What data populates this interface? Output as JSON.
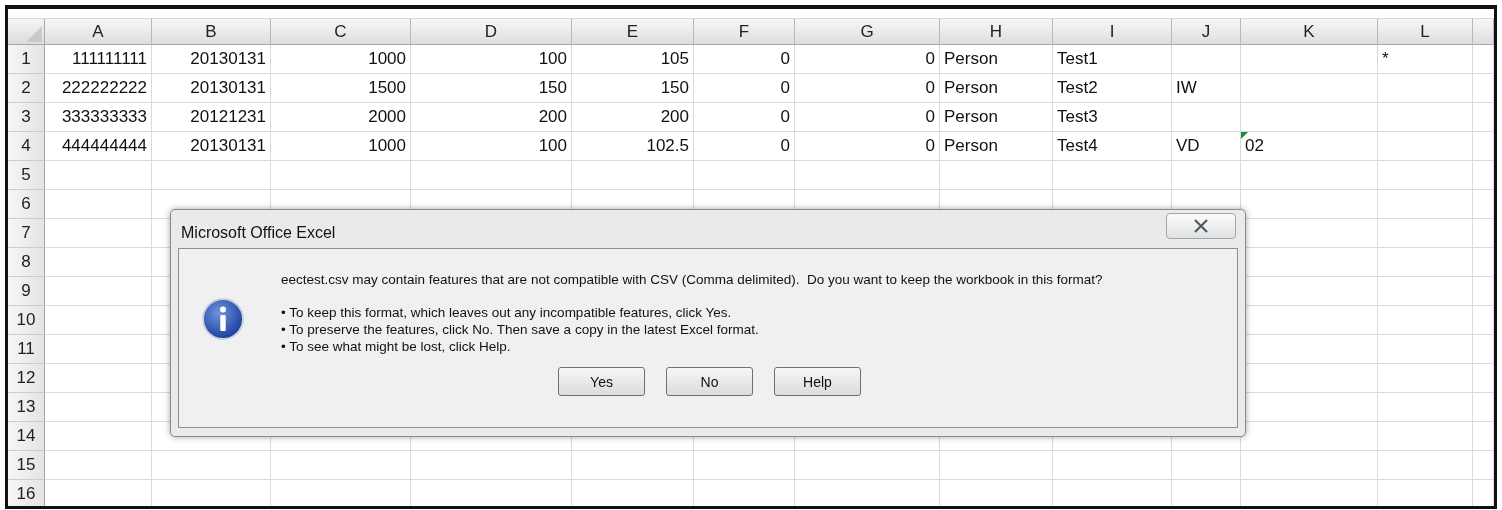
{
  "columns": [
    "A",
    "B",
    "C",
    "D",
    "E",
    "F",
    "G",
    "H",
    "I",
    "J",
    "K",
    "L"
  ],
  "rows": [
    {
      "header": "1",
      "cells": [
        {
          "text": "111111111",
          "kind": "number"
        },
        {
          "text": "20130131",
          "kind": "number"
        },
        {
          "text": "1000",
          "kind": "number"
        },
        {
          "text": "100",
          "kind": "number"
        },
        {
          "text": "105",
          "kind": "number"
        },
        {
          "text": "0",
          "kind": "number"
        },
        {
          "text": "0",
          "kind": "number"
        },
        {
          "text": "Person",
          "kind": "text"
        },
        {
          "text": "Test1",
          "kind": "text"
        },
        null,
        null,
        {
          "text": "*",
          "kind": "text"
        }
      ]
    },
    {
      "header": "2",
      "cells": [
        {
          "text": "222222222",
          "kind": "number"
        },
        {
          "text": "20130131",
          "kind": "number"
        },
        {
          "text": "1500",
          "kind": "number"
        },
        {
          "text": "150",
          "kind": "number"
        },
        {
          "text": "150",
          "kind": "number"
        },
        {
          "text": "0",
          "kind": "number"
        },
        {
          "text": "0",
          "kind": "number"
        },
        {
          "text": "Person",
          "kind": "text"
        },
        {
          "text": "Test2",
          "kind": "text"
        },
        {
          "text": "IW",
          "kind": "text"
        },
        null,
        null
      ]
    },
    {
      "header": "3",
      "cells": [
        {
          "text": "333333333",
          "kind": "number"
        },
        {
          "text": "20121231",
          "kind": "number"
        },
        {
          "text": "2000",
          "kind": "number"
        },
        {
          "text": "200",
          "kind": "number"
        },
        {
          "text": "200",
          "kind": "number"
        },
        {
          "text": "0",
          "kind": "number"
        },
        {
          "text": "0",
          "kind": "number"
        },
        {
          "text": "Person",
          "kind": "text"
        },
        {
          "text": "Test3",
          "kind": "text"
        },
        null,
        null,
        null
      ]
    },
    {
      "header": "4",
      "cells": [
        {
          "text": "444444444",
          "kind": "number"
        },
        {
          "text": "20130131",
          "kind": "number"
        },
        {
          "text": "1000",
          "kind": "number"
        },
        {
          "text": "100",
          "kind": "number"
        },
        {
          "text": "102.5",
          "kind": "number"
        },
        {
          "text": "0",
          "kind": "number"
        },
        {
          "text": "0",
          "kind": "number"
        },
        {
          "text": "Person",
          "kind": "text"
        },
        {
          "text": "Test4",
          "kind": "text"
        },
        {
          "text": "VD",
          "kind": "text"
        },
        {
          "text": "02",
          "kind": "number-as-text"
        },
        null
      ]
    },
    {
      "header": "5"
    },
    {
      "header": "6"
    },
    {
      "header": "7"
    },
    {
      "header": "8"
    },
    {
      "header": "9"
    },
    {
      "header": "10"
    },
    {
      "header": "11"
    },
    {
      "header": "12"
    },
    {
      "header": "13"
    },
    {
      "header": "14"
    },
    {
      "header": "15"
    },
    {
      "header": "16"
    }
  ],
  "dialog": {
    "title": "Microsoft Office Excel",
    "message": "eectest.csv may contain features that are not compatible with CSV (Comma delimited).  Do you want to keep the workbook in this format?",
    "bullets": [
      "• To keep this format, which leaves out any incompatible features, click Yes.",
      "• To preserve the features, click No. Then save a copy in the latest Excel format.",
      "• To see what might be lost, click Help."
    ],
    "buttons": [
      "Yes",
      "No",
      "Help"
    ]
  }
}
